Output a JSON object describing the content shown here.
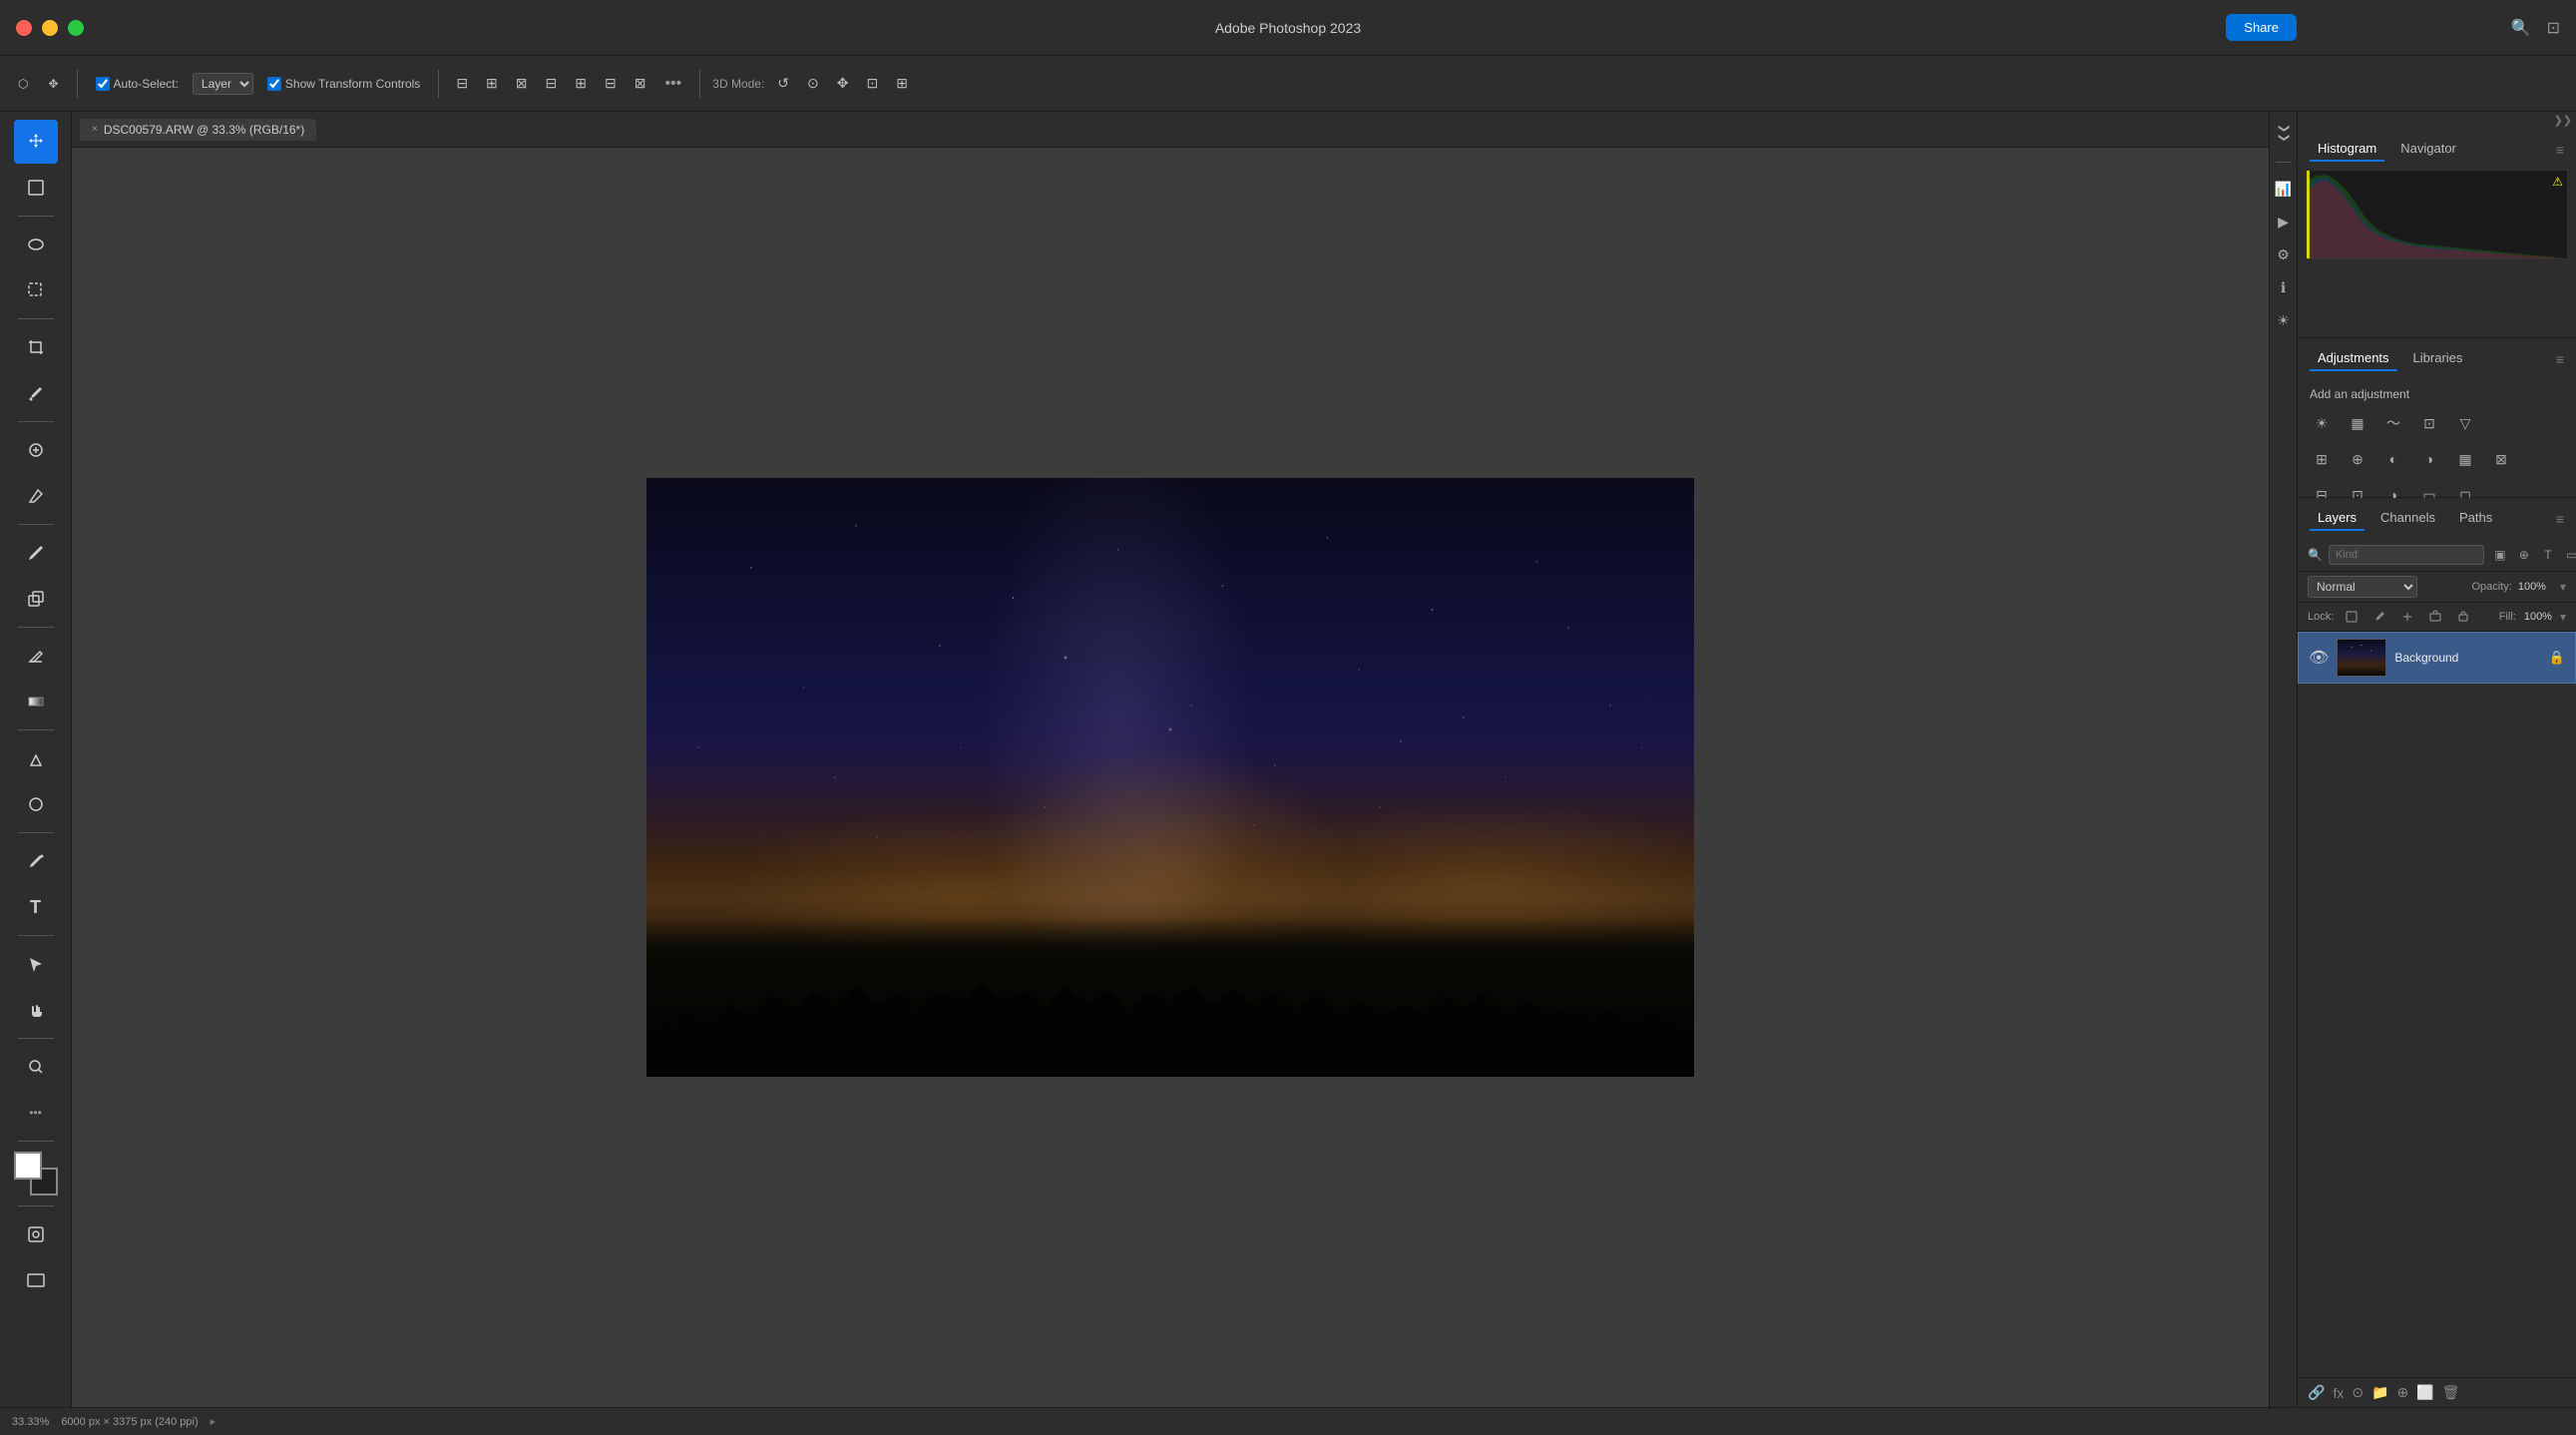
{
  "app": {
    "title": "Adobe Photoshop 2023",
    "share_label": "Share"
  },
  "titlebar": {
    "title": "Adobe Photoshop 2023",
    "share_label": "Share"
  },
  "toolbar": {
    "auto_select_label": "Auto-Select:",
    "layer_label": "Layer",
    "show_transform_controls_label": "Show Transform Controls",
    "mode_label": "3D Mode:"
  },
  "canvas_tab": {
    "filename": "DSC00579.ARW @ 33.3% (RGB/16*)",
    "close_label": "×"
  },
  "panels": {
    "histogram_tab": "Histogram",
    "navigator_tab": "Navigator",
    "adjustments_tab": "Adjustments",
    "libraries_tab": "Libraries",
    "add_adjustment_label": "Add an adjustment",
    "layers_tab": "Layers",
    "channels_tab": "Channels",
    "paths_tab": "Paths",
    "kind_placeholder": "Kind",
    "blend_mode": "Normal",
    "opacity_label": "Opacity:",
    "opacity_value": "100%",
    "fill_label": "Fill:",
    "fill_value": "100%"
  },
  "layers": [
    {
      "name": "Background",
      "visible": true,
      "locked": true,
      "thumb": "background-thumb"
    }
  ],
  "statusbar": {
    "zoom": "33.33%",
    "dimensions": "6000 px × 3375 px (240 ppi)"
  },
  "tools": [
    {
      "id": "move",
      "icon": "✥",
      "active": true
    },
    {
      "id": "lasso",
      "icon": "◎"
    },
    {
      "id": "crop",
      "icon": "⊡"
    },
    {
      "id": "eyedropper",
      "icon": "🔍"
    },
    {
      "id": "healing",
      "icon": "⊕"
    },
    {
      "id": "brush",
      "icon": "✏"
    },
    {
      "id": "clone",
      "icon": "⬚"
    },
    {
      "id": "eraser",
      "icon": "◻"
    },
    {
      "id": "gradient",
      "icon": "▣"
    },
    {
      "id": "dodge",
      "icon": "△"
    },
    {
      "id": "pen",
      "icon": "✒"
    },
    {
      "id": "type",
      "icon": "T"
    },
    {
      "id": "shape",
      "icon": "▭"
    },
    {
      "id": "hand",
      "icon": "✋"
    },
    {
      "id": "zoom",
      "icon": "🔎"
    }
  ],
  "icons": {
    "close": "×",
    "search": "🔍",
    "gear": "⚙",
    "lock": "🔒",
    "eye": "👁",
    "chevron_down": "▾",
    "chevron_right": "▸",
    "plus": "+",
    "minus": "−",
    "menu": "≡",
    "ellipsis": "•••"
  }
}
